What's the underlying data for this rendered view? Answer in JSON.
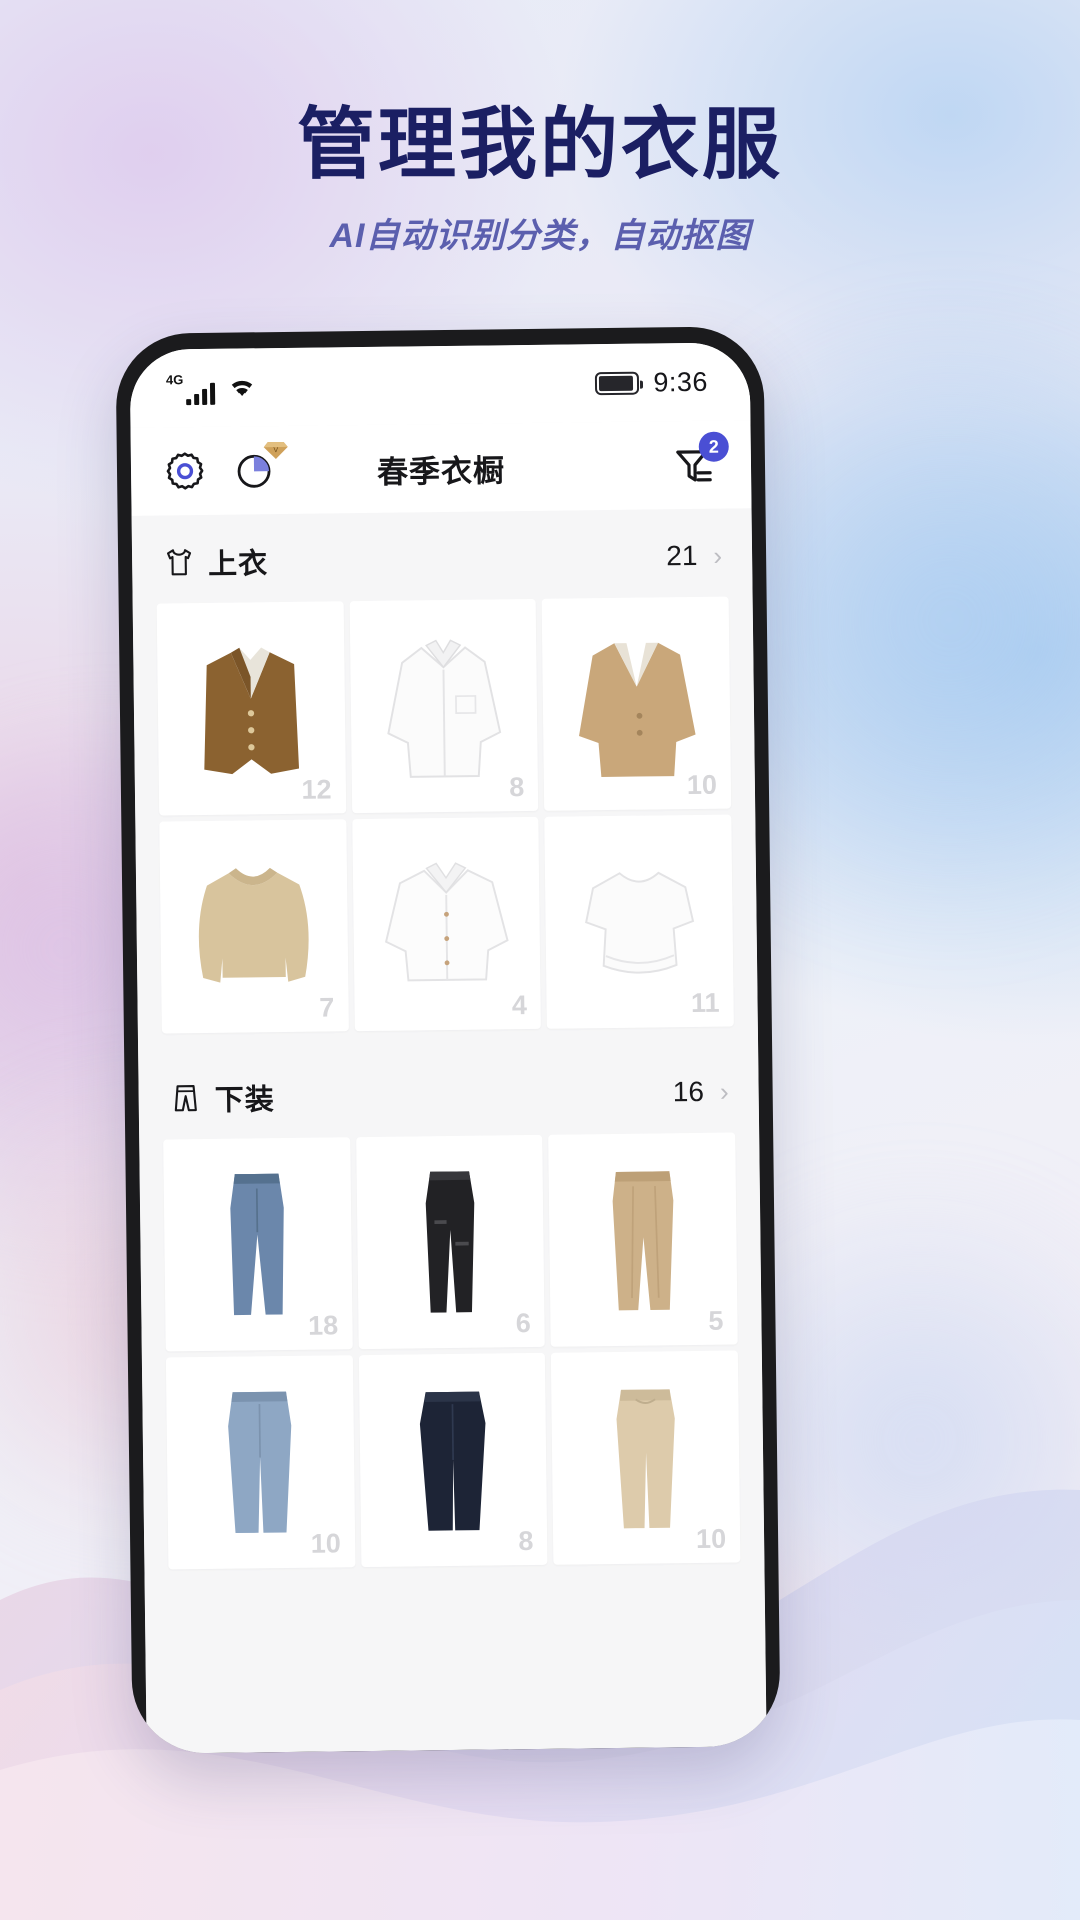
{
  "poster": {
    "title": "管理我的衣服",
    "subtitle": "AI自动识别分类，自动抠图",
    "title_color": "#1b1f63",
    "subtitle_color": "#5b5fae"
  },
  "status_bar": {
    "network": "4G",
    "signal_icon": "signal-bars-icon",
    "wifi_icon": "wifi-icon",
    "battery_icon": "battery-icon",
    "time": "9:36"
  },
  "app_header": {
    "settings_icon": "gear-icon",
    "stats_icon": "pie-chart-icon",
    "vip_icon": "vip-diamond-icon",
    "title": "春季衣橱",
    "filter_icon": "filter-icon",
    "filter_badge": "2",
    "badge_color": "#4a4fd4"
  },
  "sections": [
    {
      "icon": "tshirt-icon",
      "name": "上衣",
      "count": "21",
      "chevron": "chevron-right-icon",
      "items": [
        {
          "label": "12",
          "art": "vest-brown"
        },
        {
          "label": "8",
          "art": "shirt-white"
        },
        {
          "label": "10",
          "art": "blazer-tan"
        },
        {
          "label": "7",
          "art": "sweater-beige"
        },
        {
          "label": "4",
          "art": "jacket-white"
        },
        {
          "label": "11",
          "art": "tee-white"
        }
      ]
    },
    {
      "icon": "pants-icon",
      "name": "下装",
      "count": "16",
      "chevron": "chevron-right-icon",
      "items": [
        {
          "label": "18",
          "art": "jeans-blue"
        },
        {
          "label": "6",
          "art": "jeans-black"
        },
        {
          "label": "5",
          "art": "trousers-tan"
        },
        {
          "label": "10",
          "art": "jeans-lightblue"
        },
        {
          "label": "8",
          "art": "pants-navy"
        },
        {
          "label": "10",
          "art": "pants-beige"
        }
      ]
    }
  ]
}
